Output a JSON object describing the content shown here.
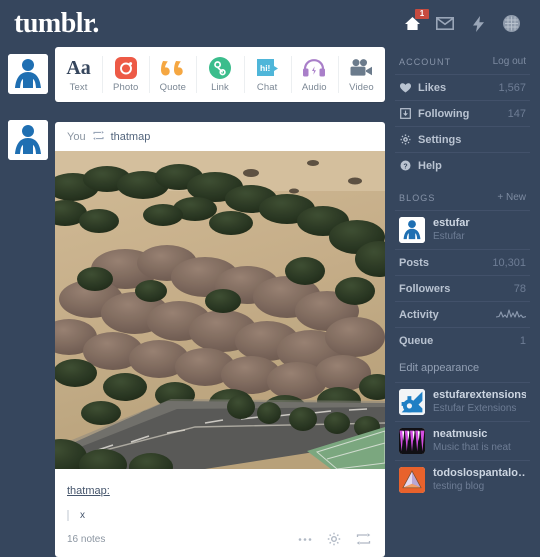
{
  "brand": {
    "logo": "tumblr.",
    "accent": "#36465d"
  },
  "topbar": {
    "icons": [
      {
        "name": "home-icon",
        "badge": "1"
      },
      {
        "name": "inbox-icon",
        "badge": ""
      },
      {
        "name": "activity-bolt-icon",
        "badge": ""
      },
      {
        "name": "account-avatar-icon",
        "badge": ""
      }
    ]
  },
  "post_types": [
    {
      "label": "Text",
      "icon": "text-icon",
      "color": "#36465d"
    },
    {
      "label": "Photo",
      "icon": "photo-icon",
      "color": "#ed5a46"
    },
    {
      "label": "Quote",
      "icon": "quote-icon",
      "color": "#f5a742"
    },
    {
      "label": "Link",
      "icon": "link-icon",
      "color": "#3bbd8c"
    },
    {
      "label": "Chat",
      "icon": "chat-icon",
      "color": "#4fb6d9"
    },
    {
      "label": "Audio",
      "icon": "audio-icon",
      "color": "#a97fc9"
    },
    {
      "label": "Video",
      "icon": "video-icon",
      "color": "#6b7b8c"
    }
  ],
  "post": {
    "header_you": "You",
    "header_icon": "reblog-icon",
    "header_source": "thatmap",
    "photo_alt": "aerial-satellite-view-of-trees-road-and-tennis-court",
    "caption_user": "thatmap:",
    "caption_quote": "x",
    "notes": "16 notes",
    "actions": [
      {
        "name": "more-options-icon"
      },
      {
        "name": "post-settings-gear-icon"
      },
      {
        "name": "reblog-icon"
      }
    ]
  },
  "sidebar": {
    "account": {
      "title": "ACCOUNT",
      "action": "Log out",
      "rows": [
        {
          "label": "Likes",
          "value": "1,567",
          "icon": "heart-icon"
        },
        {
          "label": "Following",
          "value": "147",
          "icon": "following-icon"
        },
        {
          "label": "Settings",
          "value": "",
          "icon": "gear-icon"
        },
        {
          "label": "Help",
          "value": "",
          "icon": "help-icon"
        }
      ]
    },
    "blogs": {
      "title": "BLOGS",
      "action": "+ New",
      "primary": {
        "name": "estufar",
        "desc": "Estufar",
        "avatar": "person-avatar"
      },
      "stats": [
        {
          "label": "Posts",
          "value": "10,301"
        },
        {
          "label": "Followers",
          "value": "78"
        },
        {
          "label": "Activity",
          "value": "sparkline-icon"
        },
        {
          "label": "Queue",
          "value": "1"
        }
      ],
      "edit_appearance": "Edit appearance",
      "others": [
        {
          "name": "estufarextensions",
          "desc": "Estufar Extensions",
          "avatar": "gear-blue-avatar"
        },
        {
          "name": "neatmusic",
          "desc": "Music that is neat",
          "avatar": "purple-spikes-avatar"
        },
        {
          "name": "todoslospantalo…",
          "desc": "testing blog",
          "avatar": "orange-pyramid-avatar"
        }
      ]
    }
  }
}
